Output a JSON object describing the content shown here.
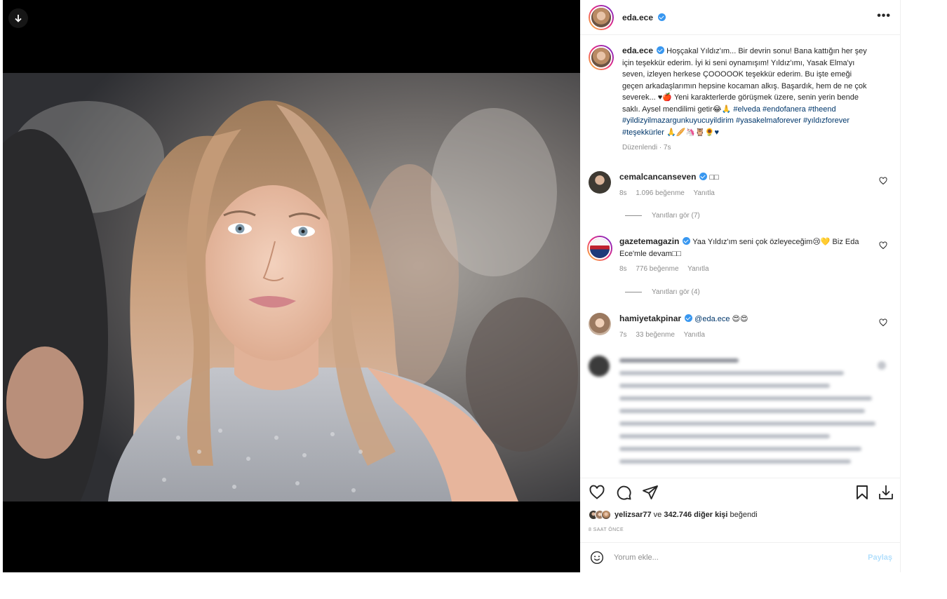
{
  "post": {
    "author": "eda.ece",
    "caption_text": "Hoşçakal Yıldız'ım... Bir devrin sonu! Bana kattığın her şey için teşekkür ederim. İyi ki seni oynamışım! Yıldız'ımı, Yasak Elma'yı seven, izleyen herkese ÇOOOOOK teşekkür ederim. Bu işte emeği geçen arkadaşlarımın hepsine kocaman alkış. Başardık, hem de ne çok severek... ♥🍎 Yeni karakterlerde görüşmek üzere, senin yerin bende saklı. Aysel mendilimi getir😂🙏",
    "caption_tags": "#elveda #endofanera #theend #yildizyilmazargunkuyucuyildirim #yasakelmaforever #yıldızforever #teşekkürler 🙏🥖🦄🦉🌻♥",
    "edited": "Düzenlendi · 7s"
  },
  "comments": [
    {
      "user": "cemalcancanseven",
      "text": "□□",
      "age": "8s",
      "likes": "1.096 beğenme",
      "reply": "Yanıtla",
      "view_replies": "Yanıtları gör (7)"
    },
    {
      "user": "gazetemagazin",
      "text": "Yaa Yıldız'ım seni çok özleyeceğim😢💛 Biz Eda Ece'mle devam□□",
      "age": "8s",
      "likes": "776 beğenme",
      "reply": "Yanıtla",
      "view_replies": "Yanıtları gör (4)"
    },
    {
      "user": "hamiyetakpinar",
      "mention": "@eda.ece",
      "text": "😍😍",
      "age": "7s",
      "likes": "33 beğenme",
      "reply": "Yanıtla"
    }
  ],
  "likes": {
    "first_user": "yelizsar77",
    "connector": "ve",
    "others": "342.746 diğer kişi",
    "suffix": "beğendi"
  },
  "timestamp": "8 SAAT ÖNCE",
  "composer": {
    "placeholder": "Yorum ekle...",
    "post_label": "Paylaş"
  },
  "icons": {
    "more": "more-options-icon",
    "like": "heart-icon",
    "comment": "comment-icon",
    "share": "share-icon",
    "save": "bookmark-icon",
    "download": "download-icon",
    "emoji": "emoji-icon"
  },
  "colors": {
    "verified": "#3897f0",
    "hashtag": "#00376b",
    "post_button_disabled": "#b2dffc",
    "muted": "#8e8e8e"
  }
}
